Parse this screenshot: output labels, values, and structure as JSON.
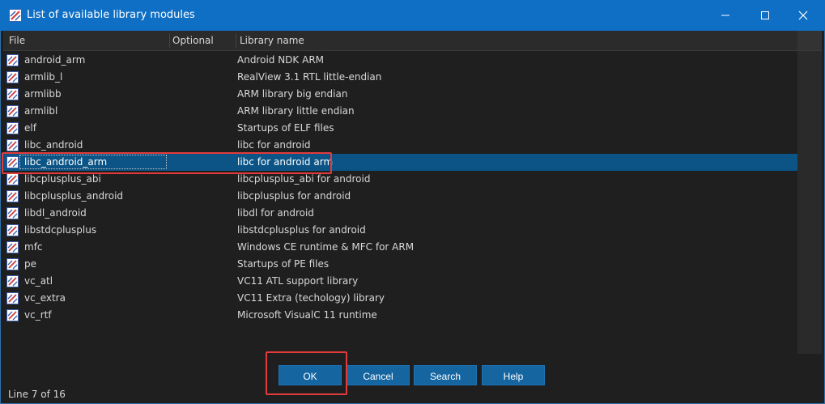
{
  "window": {
    "title": "List of available library modules",
    "accent_color": "#0f6fc4",
    "icons": {
      "app": "library-app-icon",
      "minimize": "minimize-icon",
      "maximize": "maximize-icon",
      "close": "close-icon"
    }
  },
  "table": {
    "headers": {
      "file": "File",
      "optional": "Optional",
      "library": "Library name"
    },
    "selected_index": 6,
    "rows": [
      {
        "file": "android_arm",
        "optional": "",
        "library": "Android NDK ARM"
      },
      {
        "file": "armlib_l",
        "optional": "",
        "library": "RealView 3.1 RTL little-endian"
      },
      {
        "file": "armlibb",
        "optional": "",
        "library": "ARM library big endian"
      },
      {
        "file": "armlibl",
        "optional": "",
        "library": "ARM library little endian"
      },
      {
        "file": "elf",
        "optional": "",
        "library": "Startups of ELF files"
      },
      {
        "file": "libc_android",
        "optional": "",
        "library": "libc for android"
      },
      {
        "file": "libc_android_arm",
        "optional": "",
        "library": "libc for android arm"
      },
      {
        "file": "libcplusplus_abi",
        "optional": "",
        "library": "libcplusplus_abi for android"
      },
      {
        "file": "libcplusplus_android",
        "optional": "",
        "library": "libcplusplus for android"
      },
      {
        "file": "libdl_android",
        "optional": "",
        "library": "libdl for android"
      },
      {
        "file": "libstdcplusplus",
        "optional": "",
        "library": "libstdcplusplus for android"
      },
      {
        "file": "mfc",
        "optional": "",
        "library": "Windows CE runtime & MFC for ARM"
      },
      {
        "file": "pe",
        "optional": "",
        "library": "Startups of PE files"
      },
      {
        "file": "vc_atl",
        "optional": "",
        "library": "VC11 ATL support library"
      },
      {
        "file": "vc_extra",
        "optional": "",
        "library": "VC11 Extra (techology) library"
      },
      {
        "file": "vc_rtf",
        "optional": "",
        "library": "Microsoft VisualC 11 runtime"
      }
    ]
  },
  "buttons": {
    "ok": "OK",
    "cancel": "Cancel",
    "search": "Search",
    "help": "Help"
  },
  "status": {
    "text": "Line 7 of 16"
  }
}
